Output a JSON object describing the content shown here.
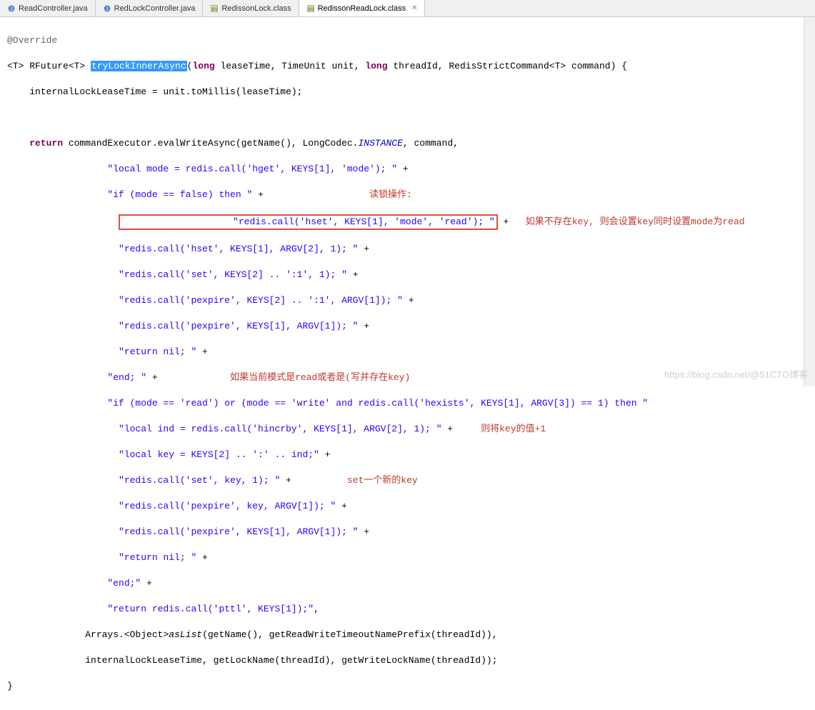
{
  "tabs": [
    {
      "label": "ReadController.java",
      "active": false,
      "icon": "java"
    },
    {
      "label": "RedLockController.java",
      "active": false,
      "icon": "java"
    },
    {
      "label": "RedissonLock.class",
      "active": false,
      "icon": "class"
    },
    {
      "label": "RedissonReadLock.class",
      "active": true,
      "icon": "class"
    }
  ],
  "code": {
    "l1": "@Override",
    "l2_pre": "<T> RFuture<T> ",
    "l2_method": "tryLockInnerAsync",
    "l2_paren": "(",
    "l2_kw1": "long",
    "l2_p1": " leaseTime, TimeUnit unit, ",
    "l2_kw2": "long",
    "l2_p2": " threadId, RedisStrictCommand<T> command) {",
    "l3": "    internalLockLeaseTime = unit.toMillis(leaseTime);",
    "l4_blank": "",
    "l5_kw": "    return",
    "l5_rest": " commandExecutor.evalWriteAsync(getName(), LongCodec.",
    "l5_inst": "INSTANCE",
    "l5_end": ", command,",
    "l6_s": "                  \"local mode = redis.call('hget', KEYS[1], 'mode'); \"",
    "l7_s": "                  \"if (mode == false) then \"",
    "l8_s": "                    \"redis.call('hset', KEYS[1], 'mode', 'read'); \"",
    "l9_s": "                    \"redis.call('hset', KEYS[1], ARGV[2], 1); \"",
    "l10_s": "                    \"redis.call('set', KEYS[2] .. ':1', 1); \"",
    "l11_s": "                    \"redis.call('pexpire', KEYS[2] .. ':1', ARGV[1]); \"",
    "l12_s": "                    \"redis.call('pexpire', KEYS[1], ARGV[1]); \"",
    "l13_s": "                    \"return nil; \"",
    "l14_s": "                  \"end; \"",
    "l15_s": "                  \"if (mode == 'read') or (mode == 'write' and redis.call('hexists', KEYS[1], ARGV[3]) == 1) then \"",
    "l16_s": "                    \"local ind = redis.call('hincrby', KEYS[1], ARGV[2], 1); \"",
    "l17_s": "                    \"local key = KEYS[2] .. ':' .. ind;\"",
    "l18_s": "                    \"redis.call('set', key, 1); \"",
    "l19_s": "                    \"redis.call('pexpire', key, ARGV[1]); \"",
    "l20_s": "                    \"redis.call('pexpire', KEYS[1], ARGV[1]); \"",
    "l21_s": "                    \"return nil; \"",
    "l22_s": "                  \"end;\"",
    "l23_s": "                  \"return redis.call('pttl', KEYS[1]);\"",
    "l24": "              Arrays.<Object>",
    "l24_m": "asList",
    "l24_e": "(getName(), getReadWriteTimeoutNamePrefix(threadId)),",
    "l25": "              internalLockLeaseTime, getLockName(threadId), getWriteLockName(threadId));",
    "l26": "}",
    "plus": " +",
    "comma": ","
  },
  "annotations": {
    "read_lock_title": "读锁操作:",
    "read_lock_desc": "如果不存在key, 则会设置key同时设置mode为read",
    "mode_read_desc": "如果当前模式是read或者是(写并存在key)",
    "incr_desc": "则将key的值+1",
    "set_new_key": "set一个新的key"
  },
  "watermark": "https://blog.csdn.net/@51CTO博客"
}
